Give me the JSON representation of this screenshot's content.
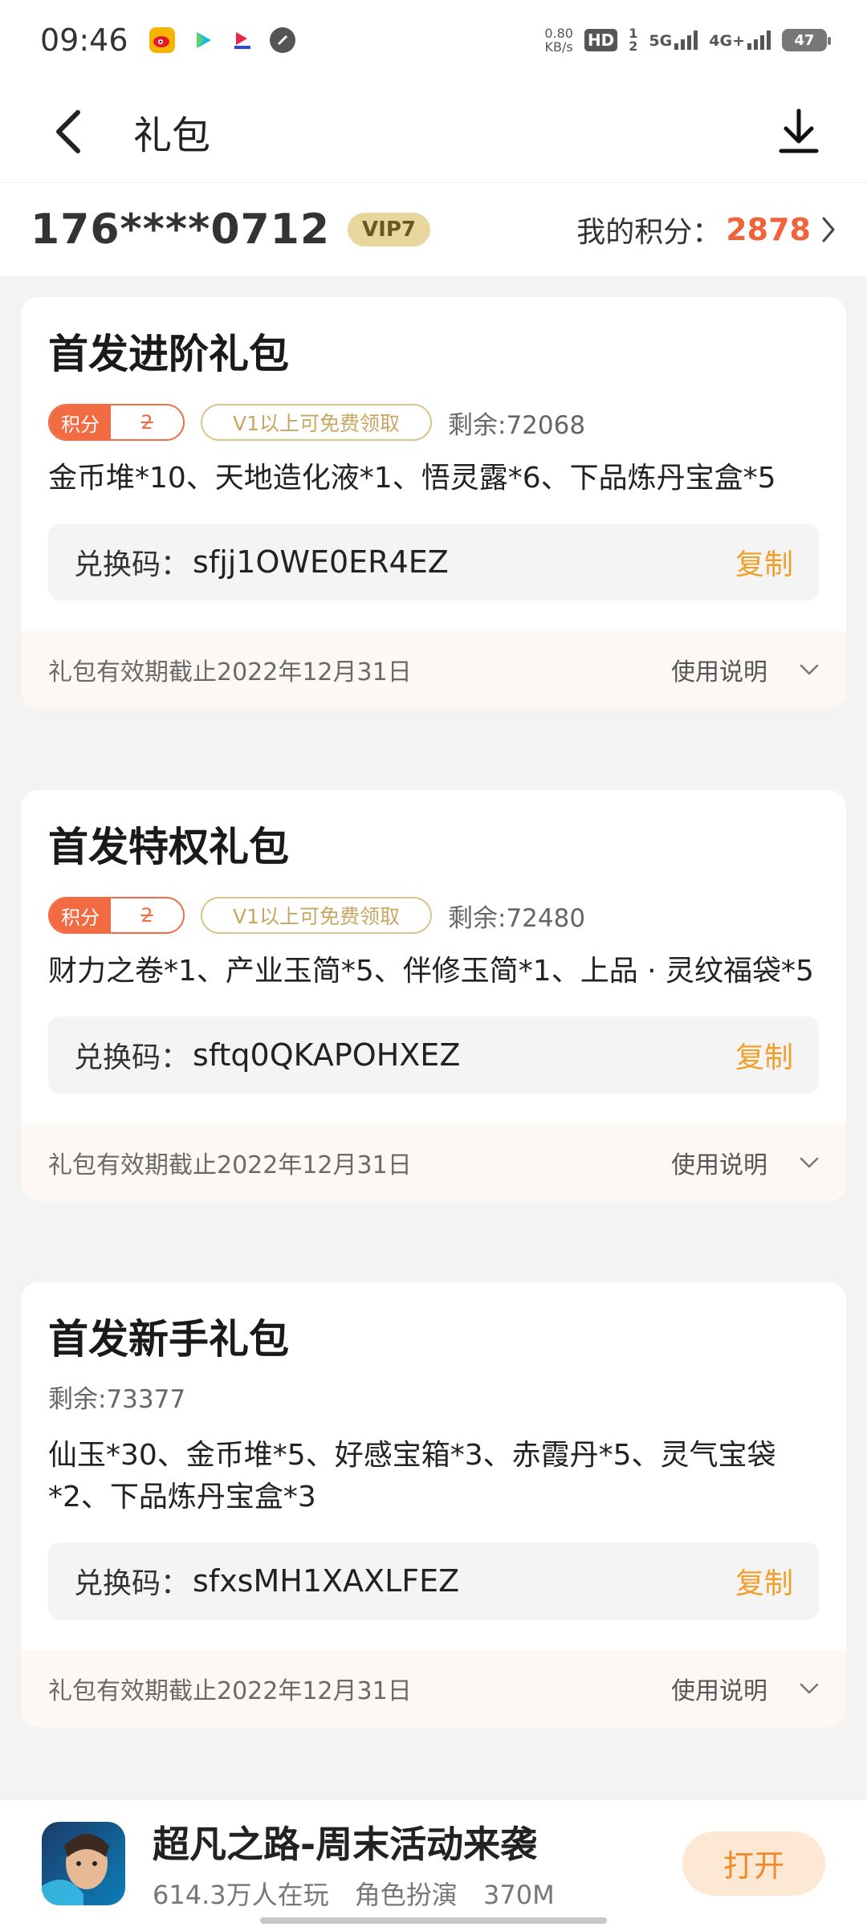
{
  "status_bar": {
    "time": "09:46",
    "net_speed_value": "0.80",
    "net_speed_unit": "KB/s",
    "hd_label": "HD",
    "sim_1": "1",
    "sim_2": "2",
    "network_1": "5G",
    "network_2": "4G+",
    "battery": "47",
    "app_icons": [
      "weibo-icon",
      "video-play-icon",
      "app-icon",
      "settings-circle-icon"
    ]
  },
  "nav": {
    "title": "礼包"
  },
  "account": {
    "phone": "176****0712",
    "vip": "VIP7",
    "points_label": "我的积分：",
    "points_value": "2878"
  },
  "packs": [
    {
      "title": "首发进阶礼包",
      "points_tag": "积分",
      "points_cost": "2",
      "vip_tag": "V1以上可免费领取",
      "remaining": "剩余:72068",
      "contents": "金币堆*10、天地造化液*1、悟灵露*6、下品炼丹宝盒*5",
      "code_label": "兑换码：",
      "code": "sfjj1OWE0ER4EZ",
      "copy": "复制",
      "expiry": "礼包有效期截止2022年12月31日",
      "usage": "使用说明"
    },
    {
      "title": "首发特权礼包",
      "points_tag": "积分",
      "points_cost": "2",
      "vip_tag": "V1以上可免费领取",
      "remaining": "剩余:72480",
      "contents": "财力之卷*1、产业玉简*5、伴修玉简*1、上品 · 灵纹福袋*5",
      "code_label": "兑换码：",
      "code": "sftq0QKAPOHXEZ",
      "copy": "复制",
      "expiry": "礼包有效期截止2022年12月31日",
      "usage": "使用说明"
    },
    {
      "title": "首发新手礼包",
      "remaining": "剩余:73377",
      "contents": "仙玉*30、金币堆*5、好感宝箱*3、赤霞丹*5、灵气宝袋*2、下品炼丹宝盒*3",
      "code_label": "兑换码：",
      "code": "sfxsMH1XAXLFEZ",
      "copy": "复制",
      "expiry": "礼包有效期截止2022年12月31日",
      "usage": "使用说明"
    }
  ],
  "game": {
    "title": "超凡之路-周末活动来袭",
    "players": "614.3万人在玩",
    "genre": "角色扮演",
    "size": "370M",
    "open_label": "打开"
  },
  "colors": {
    "accent_orange": "#f0643c",
    "copy_orange": "#f0a02a",
    "vip_gold": "#e7d79d",
    "page_bg": "#f3f3f3"
  }
}
